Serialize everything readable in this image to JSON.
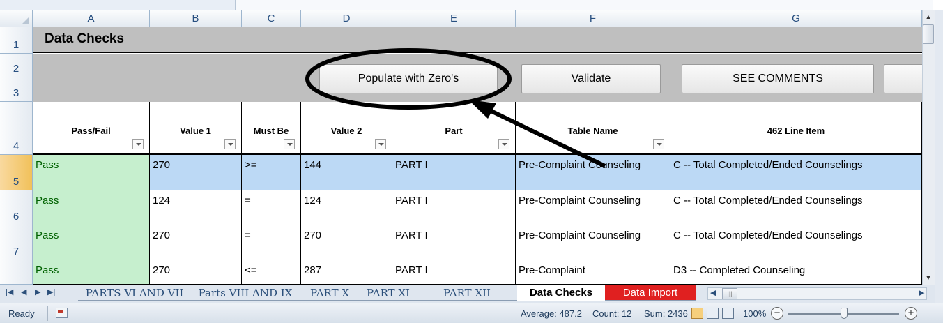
{
  "columns": [
    "A",
    "B",
    "C",
    "D",
    "E",
    "F",
    "G"
  ],
  "rows": [
    "1",
    "2",
    "3",
    "4",
    "5",
    "6",
    "7",
    ""
  ],
  "title": "Data Checks",
  "buttons": {
    "populate": "Populate with Zero's",
    "validate": "Validate",
    "see_comments": "SEE COMMENTS"
  },
  "headers": [
    "Pass/Fail",
    "Value 1",
    "Must Be",
    "Value 2",
    "Part",
    "Table Name",
    "462 Line Item"
  ],
  "data_rows": [
    {
      "pass": "Pass",
      "v1": "270",
      "must": ">=",
      "v2": "144",
      "part": "PART I",
      "table": "Pre-Complaint Counseling",
      "line": "C -- Total Completed/Ended Counselings"
    },
    {
      "pass": "Pass",
      "v1": "124",
      "must": "=",
      "v2": "124",
      "part": "PART I",
      "table": "Pre-Complaint Counseling",
      "line": "C -- Total Completed/Ended Counselings"
    },
    {
      "pass": "Pass",
      "v1": "270",
      "must": "=",
      "v2": "270",
      "part": "PART I",
      "table": "Pre-Complaint Counseling",
      "line": "C -- Total Completed/Ended Counselings"
    },
    {
      "pass": "Pass",
      "v1": "270",
      "must": "<=",
      "v2": "287",
      "part": "PART I",
      "table": "Pre-Complaint",
      "line": "D3 -- Completed Counseling"
    }
  ],
  "sheet_tabs": [
    "PARTS VI AND VII",
    "Parts VIII AND IX",
    "PART X",
    "PART XI",
    "PART XII",
    "Data Checks",
    "Data Import"
  ],
  "status": {
    "ready": "Ready",
    "average": "Average: 487.2",
    "count": "Count: 12",
    "sum": "Sum: 2436",
    "zoom": "100%"
  },
  "colors": {
    "pass_fill": "#c6efce",
    "pass_text": "#006100",
    "selection": "#bcd9f5",
    "active_tab_red": "#e02020"
  }
}
